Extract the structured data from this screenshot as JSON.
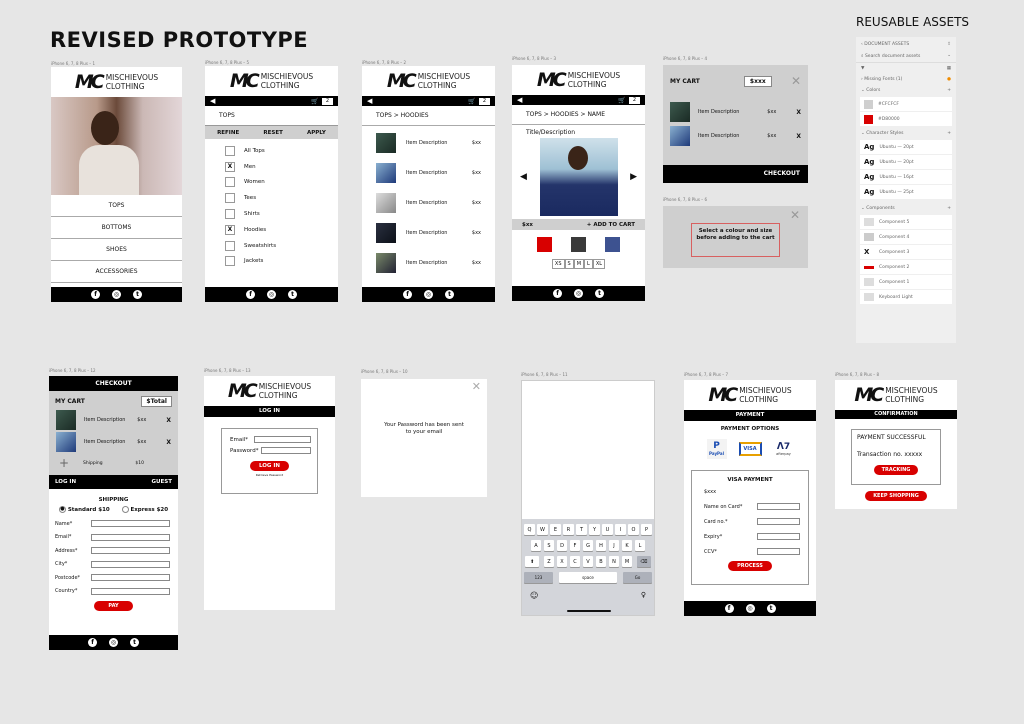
{
  "page": {
    "title": "REVISED PROTOTYPE",
    "assets_title": "REUSABLE ASSETS"
  },
  "brand": {
    "mark": "MC",
    "line1": "MISCHIEVOUS",
    "line2": "CLOTHING",
    "accent": "#D80000",
    "grey": "#CFCFCF"
  },
  "social": {
    "facebook": "f",
    "instagram": "◎",
    "twitter": "t"
  },
  "nav": {
    "back": "◀",
    "cart_icon": "🛒",
    "cart_count": "2"
  },
  "artboards": {
    "home": {
      "label": "iPhone 6, 7, 8 Plus – 1",
      "menu": [
        "TOPS",
        "BOTTOMS",
        "SHOES",
        "ACCESSORIES"
      ]
    },
    "filter": {
      "label": "iPhone 6, 7, 8 Plus – 5",
      "crumb": "TOPS",
      "refine": "REFINE",
      "reset": "RESET",
      "apply": "APPLY",
      "options": [
        {
          "label": "All Tops",
          "mark": ""
        },
        {
          "label": "Men",
          "mark": "X"
        },
        {
          "label": "Women",
          "mark": ""
        },
        {
          "label": "Tees",
          "mark": ""
        },
        {
          "label": "Shirts",
          "mark": ""
        },
        {
          "label": "Hoodies",
          "mark": "X"
        },
        {
          "label": "Sweatshirts",
          "mark": ""
        },
        {
          "label": "Jackets",
          "mark": ""
        }
      ]
    },
    "list": {
      "label": "iPhone 6, 7, 8 Plus – 2",
      "crumb": "TOPS > HOODIES",
      "items": [
        {
          "desc": "Item Description",
          "price": "$xx"
        },
        {
          "desc": "Item Description",
          "price": "$xx"
        },
        {
          "desc": "Item Description",
          "price": "$xx"
        },
        {
          "desc": "Item Description",
          "price": "$xx"
        },
        {
          "desc": "Item Description",
          "price": "$xx"
        }
      ]
    },
    "product": {
      "label": "iPhone 6, 7, 8 Plus – 3",
      "crumb": "TOPS > HOODIES > NAME",
      "title": "Title/Description",
      "price": "$xx",
      "add": "+ ADD TO CART",
      "prev": "◀",
      "next": "▶",
      "colors": [
        "#D80000",
        "#3A3A3A",
        "#3D5290"
      ],
      "sizes": [
        "XS",
        "S",
        "M",
        "L",
        "XL"
      ]
    },
    "cart": {
      "label": "iPhone 6, 7, 8 Plus – 4",
      "heading": "MY CART",
      "total": "$xxx",
      "close": "✕",
      "items": [
        {
          "desc": "Item Description",
          "price": "$xx",
          "remove": "X"
        },
        {
          "desc": "Item Description",
          "price": "$xx",
          "remove": "X"
        }
      ],
      "checkout": "CHECKOUT"
    },
    "alert": {
      "label": "iPhone 6, 7, 8 Plus – 6",
      "message": "Select a colour and size before adding to the cart",
      "close": "✕"
    },
    "checkout": {
      "label": "iPhone 6, 7, 8 Plus – 12",
      "header": "CHECKOUT",
      "heading": "MY CART",
      "total": "$Total",
      "items": [
        {
          "desc": "Item Description",
          "price": "$xx",
          "remove": "X"
        },
        {
          "desc": "Item Description",
          "price": "$xx",
          "remove": "X"
        }
      ],
      "shipping_label": "Shipping",
      "shipping_price": "$10",
      "login": "LOG IN",
      "guest": "GUEST",
      "shipping_heading": "SHIPPING",
      "standard": "Standard $10",
      "express": "Express $20",
      "fields": [
        "Name*",
        "Email*",
        "Address*",
        "City*",
        "Postcode*",
        "Country*"
      ],
      "pay": "PAY"
    },
    "login": {
      "label": "iPhone 6, 7, 8 Plus – 13",
      "header": "LOG IN",
      "email": "Email*",
      "password": "Password*",
      "button": "LOG IN",
      "retrieve": "Retrieve Password"
    },
    "password_sent": {
      "label": "iPhone 6, 7, 8 Plus – 10",
      "message": "Your Password has been sent to your email",
      "close": "✕"
    },
    "keyboard": {
      "label": "iPhone 6, 7, 8 Plus – 11",
      "row1": [
        "Q",
        "W",
        "E",
        "R",
        "T",
        "Y",
        "U",
        "I",
        "O",
        "P"
      ],
      "row2": [
        "A",
        "S",
        "D",
        "F",
        "G",
        "H",
        "J",
        "K",
        "L"
      ],
      "row3": [
        "Z",
        "X",
        "C",
        "V",
        "B",
        "N",
        "M"
      ],
      "shift": "⬆",
      "delete": "⌫",
      "numbers": "123",
      "space": "space",
      "go": "Go",
      "emoji": "☺",
      "mic": "🎙"
    },
    "payment": {
      "label": "iPhone 6, 7, 8 Plus – 7",
      "header": "PAYMENT",
      "options_heading": "PAYMENT OPTIONS",
      "methods": [
        "PayPal",
        "VISA",
        "afterpay"
      ],
      "visa_heading": "VISA PAYMENT",
      "amount": "$xxx",
      "fields": [
        "Name on Card*",
        "Card no.*",
        "Expiry*",
        "CCV*"
      ],
      "process": "PROCESS"
    },
    "confirmation": {
      "label": "iPhone 6, 7, 8 Plus – 8",
      "header": "CONFIRMATION",
      "success": "PAYMENT SUCCESSFUL",
      "transaction": "Transaction no. xxxxx",
      "tracking": "TRACKING",
      "keep": "KEEP SHOPPING"
    }
  },
  "assets": {
    "back_label": "DOCUMENT ASSETS",
    "search_placeholder": "Search document assets",
    "missing_fonts": "Missing Fonts (1)",
    "colors_heading": "Colors",
    "colors": [
      {
        "hex": "#CFCFCF",
        "label": "#CFCFCF"
      },
      {
        "hex": "#D80000",
        "label": "#D80000"
      }
    ],
    "char_heading": "Character Styles",
    "char_styles": [
      "Ubuntu — 20pt",
      "Ubuntu — 20pt",
      "Ubuntu — 16pt",
      "Ubuntu — 25pt"
    ],
    "ag": "Ag",
    "comp_heading": "Components",
    "components": [
      "Component 5",
      "Component 4",
      "Component 3",
      "Component 2",
      "Component 1",
      "Keyboard Light"
    ]
  }
}
